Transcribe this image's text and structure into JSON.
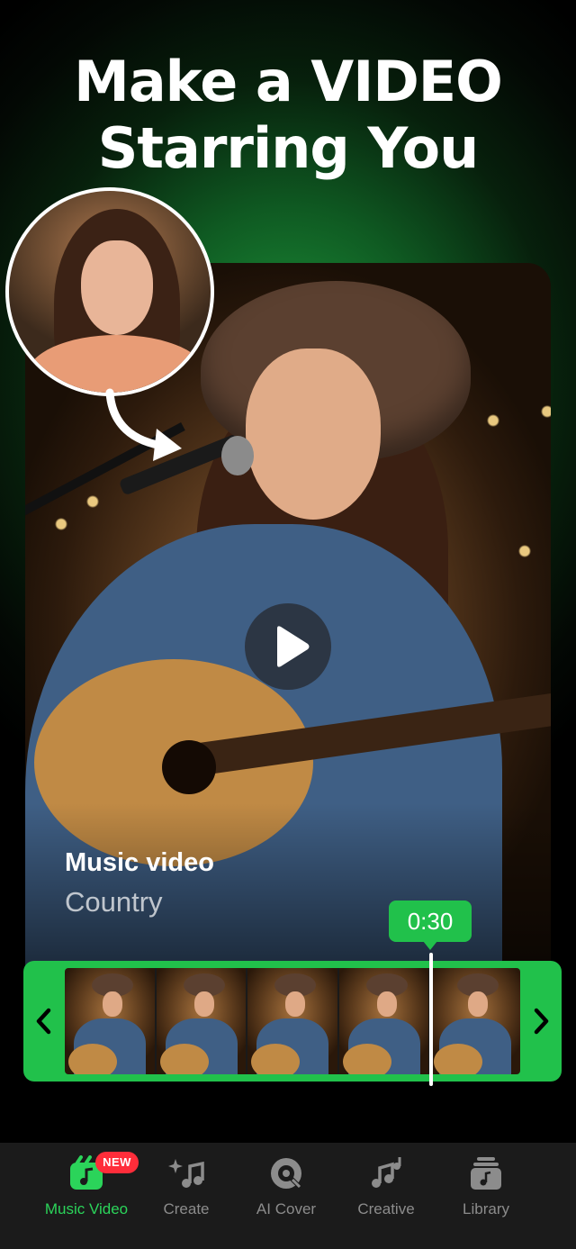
{
  "headline": {
    "line1": "Make a VIDEO",
    "line2": "Starring You"
  },
  "card": {
    "title": "Music video",
    "subtitle": "Country"
  },
  "timeline": {
    "time": "0:30"
  },
  "tabs": [
    {
      "label": "Music Video",
      "icon": "music-video-icon",
      "active": true,
      "badge": "NEW"
    },
    {
      "label": "Create",
      "icon": "create-music-icon",
      "active": false
    },
    {
      "label": "AI Cover",
      "icon": "ai-cover-icon",
      "active": false
    },
    {
      "label": "Creative",
      "icon": "creative-icon",
      "active": false
    },
    {
      "label": "Library",
      "icon": "library-icon",
      "active": false
    }
  ],
  "colors": {
    "accent": "#21c14b",
    "active_tab": "#2bd45a",
    "inactive_tab": "#8c8c8c",
    "badge": "#ff2d3a",
    "tabbar_bg": "#1b1b1b"
  }
}
